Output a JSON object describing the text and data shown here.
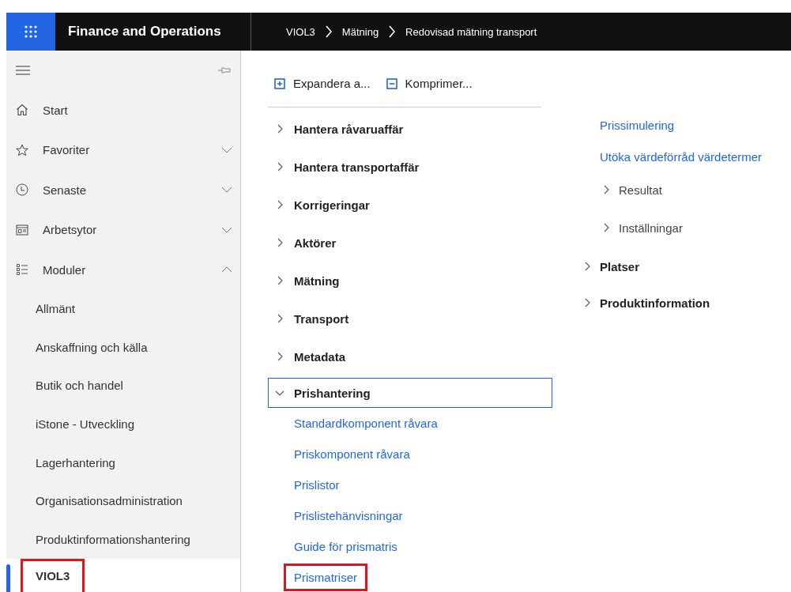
{
  "header": {
    "app_title": "Finance and Operations",
    "breadcrumb": [
      "VIOL3",
      "Mätning",
      "Redovisad mätning transport"
    ]
  },
  "sidebar": {
    "nav": [
      {
        "label": "Start",
        "kind": "home"
      },
      {
        "label": "Favoriter",
        "kind": "favorites",
        "expanded": false
      },
      {
        "label": "Senaste",
        "kind": "recent",
        "expanded": false
      },
      {
        "label": "Arbetsytor",
        "kind": "workspaces",
        "expanded": false
      },
      {
        "label": "Moduler",
        "kind": "modules",
        "expanded": true
      }
    ],
    "modules": [
      {
        "label": "Allmänt",
        "selected": false,
        "highlighted": false
      },
      {
        "label": "Anskaffning och källa",
        "selected": false,
        "highlighted": false
      },
      {
        "label": "Butik och handel",
        "selected": false,
        "highlighted": false
      },
      {
        "label": "iStone - Utveckling",
        "selected": false,
        "highlighted": false
      },
      {
        "label": "Lagerhantering",
        "selected": false,
        "highlighted": false
      },
      {
        "label": "Organisationsadministration",
        "selected": false,
        "highlighted": false
      },
      {
        "label": "Produktinformationshantering",
        "selected": false,
        "highlighted": false
      },
      {
        "label": "VIOL3",
        "selected": true,
        "highlighted": true
      }
    ]
  },
  "toolbar": {
    "expand_all": "Expandera a...",
    "collapse_all": "Komprimer..."
  },
  "menu_column_1": [
    {
      "label": "Hantera råvaruaffär",
      "expanded": false,
      "focused": false
    },
    {
      "label": "Hantera transportaffär",
      "expanded": false,
      "focused": false
    },
    {
      "label": "Korrigeringar",
      "expanded": false,
      "focused": false
    },
    {
      "label": "Aktörer",
      "expanded": false,
      "focused": false
    },
    {
      "label": "Mätning",
      "expanded": false,
      "focused": false
    },
    {
      "label": "Transport",
      "expanded": false,
      "focused": false
    },
    {
      "label": "Metadata",
      "expanded": false,
      "focused": false
    },
    {
      "label": "Prishantering",
      "expanded": true,
      "focused": true,
      "children": [
        {
          "label": "Standardkomponent råvara",
          "highlighted": false
        },
        {
          "label": "Priskomponent råvara",
          "highlighted": false
        },
        {
          "label": "Prislistor",
          "highlighted": false
        },
        {
          "label": "Prislistehänvisningar",
          "highlighted": false
        },
        {
          "label": "Guide för prismatris",
          "highlighted": false
        },
        {
          "label": "Prismatriser",
          "highlighted": true
        }
      ]
    }
  ],
  "menu_column_2": [
    {
      "kind": "link",
      "label": "Prissimulering"
    },
    {
      "kind": "link",
      "label": "Utöka värdeförråd värdetermer"
    },
    {
      "kind": "subgroup",
      "label": "Resultat",
      "expanded": false
    },
    {
      "kind": "subgroup",
      "label": "Inställningar",
      "expanded": false
    },
    {
      "kind": "group",
      "label": "Platser",
      "expanded": false
    },
    {
      "kind": "group",
      "label": "Produktinformation",
      "expanded": false
    }
  ]
}
